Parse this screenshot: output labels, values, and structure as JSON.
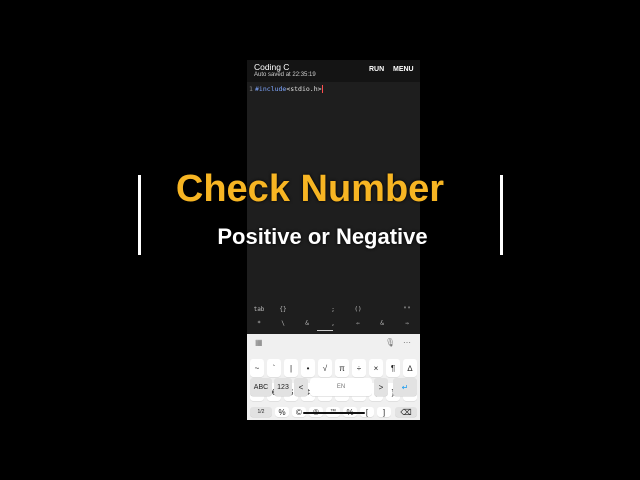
{
  "app": {
    "title": "Coding C",
    "autosave": "Auto saved at 22:35:19",
    "run_label": "RUN",
    "menu_label": "MENU"
  },
  "editor": {
    "line_number": "1",
    "keyword": "#include",
    "rest": "<stdio.h>"
  },
  "symbol_bar": {
    "row1": [
      "tab",
      "{}",
      ";",
      "()",
      "\"\""
    ],
    "row2": [
      "*",
      "\\",
      "&",
      ",",
      "⇐",
      "&",
      "⇒"
    ]
  },
  "keyboard": {
    "row1": [
      "~",
      "`",
      "|",
      "•",
      "√",
      "π",
      "÷",
      "×",
      "¶",
      "∆"
    ],
    "row2": [
      "£",
      "€",
      "$",
      "¢",
      "^",
      "°",
      "=",
      "{",
      "}",
      "\\"
    ],
    "row3": [
      "1/2",
      "%",
      "©",
      "®",
      "™",
      "%",
      "[",
      "]",
      "⌫"
    ],
    "row4": [
      "ABC",
      "123",
      "<",
      "EN",
      ">",
      "↵"
    ]
  },
  "overlay": {
    "title": "Check Number",
    "subtitle": "Positive or Negative"
  }
}
